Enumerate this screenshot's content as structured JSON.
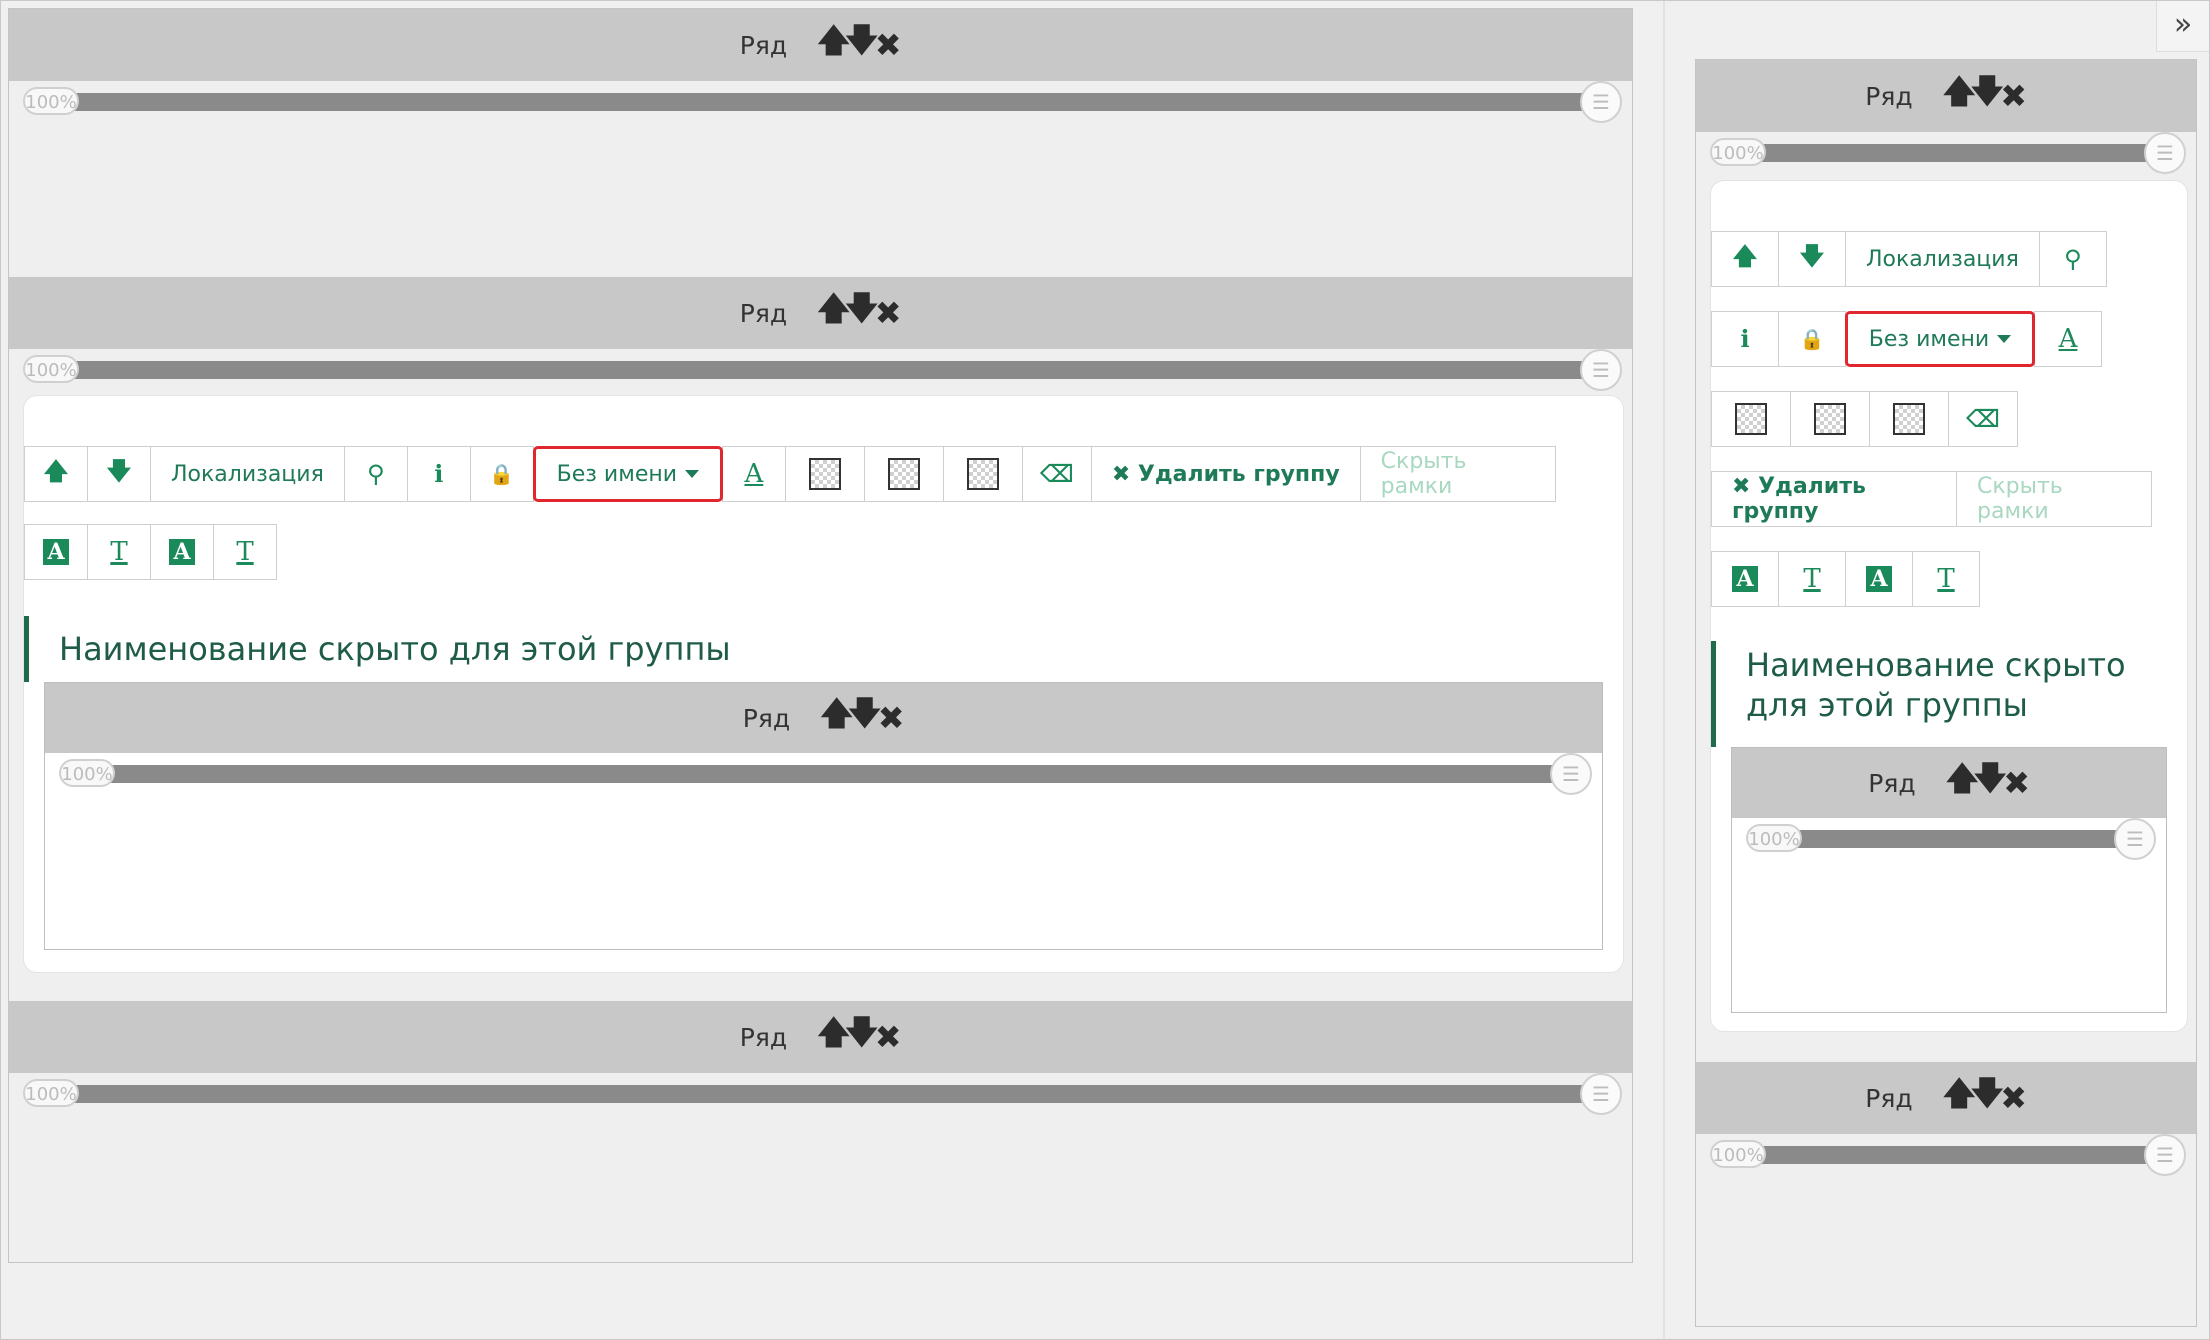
{
  "row": {
    "label": "Ряд",
    "up": "🡅",
    "down": "🡇",
    "remove": "✖",
    "percent": "100%"
  },
  "toolbar": {
    "move_up": "🡅",
    "move_down": "🡇",
    "localization": "Локализация",
    "binoculars": "⚲",
    "info": "ℹ",
    "lock": "🔒",
    "name_dropdown": "Без имени",
    "text_color": "A",
    "eraser": "⌫",
    "delete_group": "✖ Удалить группу",
    "hide_frames": "Скрыть рамки",
    "style_a_box": "A",
    "style_t": "T"
  },
  "group": {
    "hidden_title": "Наименование скрыто для этой группы",
    "hidden_title_line1": "Наименование скрыто",
    "hidden_title_line2": "для этой группы"
  },
  "sidebar": {
    "collapse": "»"
  },
  "colors": {
    "accent": "#1b8a5a",
    "highlight": "#e0262e",
    "row_header": "#c8c8c8"
  }
}
